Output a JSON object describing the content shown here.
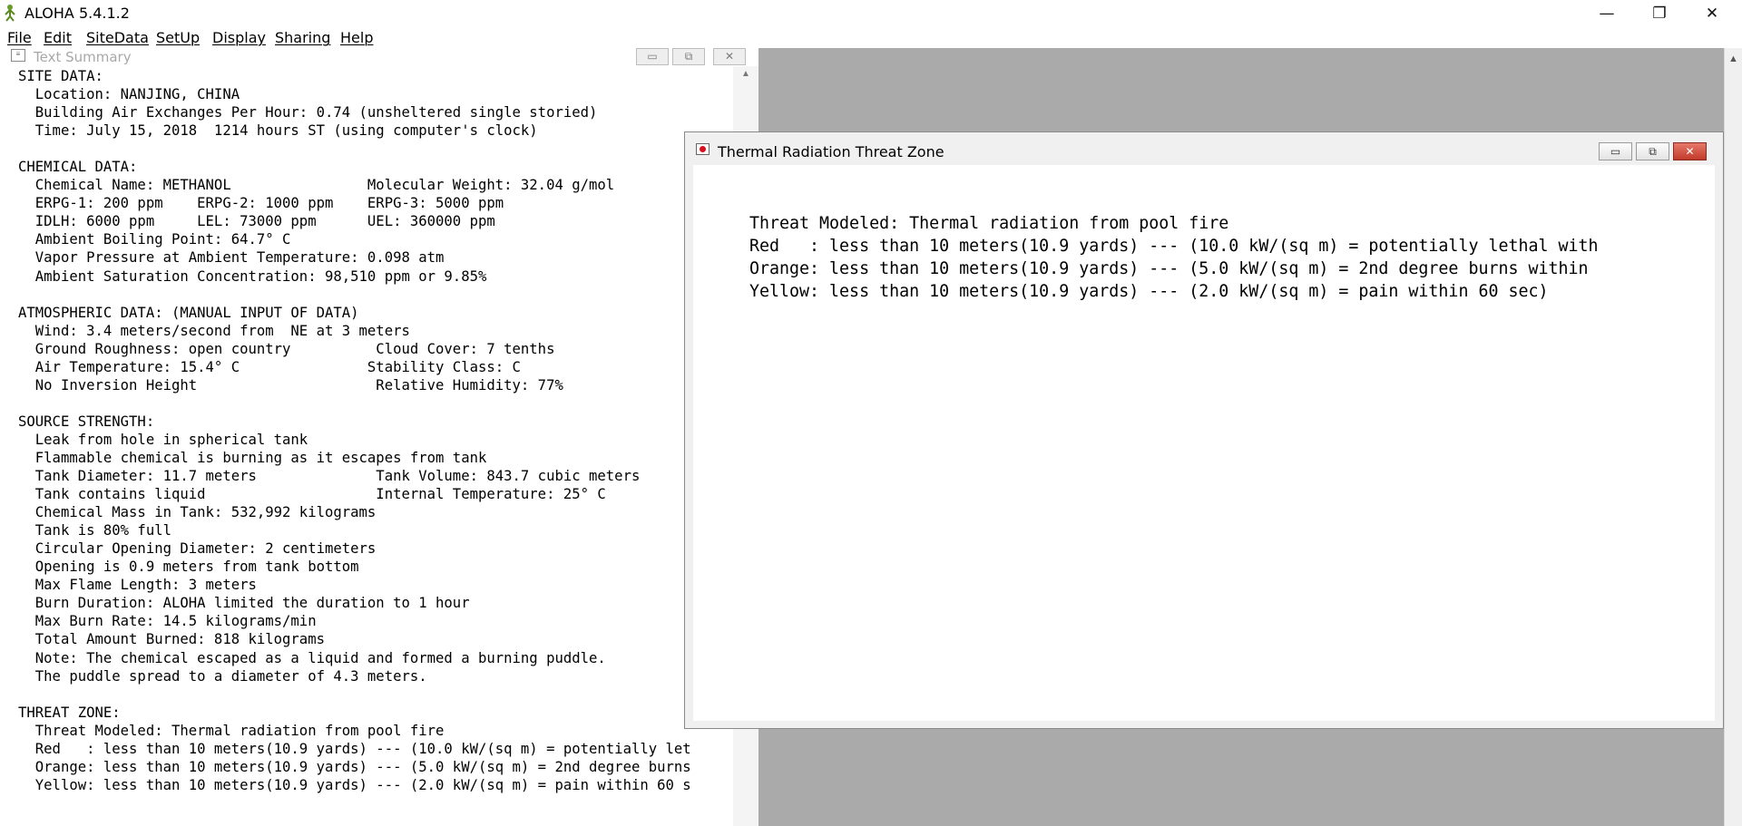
{
  "app": {
    "title": "ALOHA 5.4.1.2",
    "minimize": "—",
    "restore": "❐",
    "close": "✕"
  },
  "menu": {
    "file": "File",
    "edit": "Edit",
    "sitedata": "SiteData",
    "setup": "SetUp",
    "display": "Display",
    "sharing": "Sharing",
    "help": "Help"
  },
  "summary": {
    "title": "Text Summary",
    "content": "SITE DATA:\n  Location: NANJING, CHINA\n  Building Air Exchanges Per Hour: 0.74 (unsheltered single storied)\n  Time: July 15, 2018  1214 hours ST (using computer's clock)\n\nCHEMICAL DATA:\n  Chemical Name: METHANOL                Molecular Weight: 32.04 g/mol\n  ERPG-1: 200 ppm    ERPG-2: 1000 ppm    ERPG-3: 5000 ppm\n  IDLH: 6000 ppm     LEL: 73000 ppm      UEL: 360000 ppm\n  Ambient Boiling Point: 64.7° C\n  Vapor Pressure at Ambient Temperature: 0.098 atm\n  Ambient Saturation Concentration: 98,510 ppm or 9.85%\n\nATMOSPHERIC DATA: (MANUAL INPUT OF DATA)\n  Wind: 3.4 meters/second from  NE at 3 meters\n  Ground Roughness: open country          Cloud Cover: 7 tenths\n  Air Temperature: 15.4° C               Stability Class: C\n  No Inversion Height                     Relative Humidity: 77%\n\nSOURCE STRENGTH:\n  Leak from hole in spherical tank\n  Flammable chemical is burning as it escapes from tank\n  Tank Diameter: 11.7 meters              Tank Volume: 843.7 cubic meters\n  Tank contains liquid                    Internal Temperature: 25° C\n  Chemical Mass in Tank: 532,992 kilograms\n  Tank is 80% full\n  Circular Opening Diameter: 2 centimeters\n  Opening is 0.9 meters from tank bottom\n  Max Flame Length: 3 meters\n  Burn Duration: ALOHA limited the duration to 1 hour\n  Max Burn Rate: 14.5 kilograms/min\n  Total Amount Burned: 818 kilograms\n  Note: The chemical escaped as a liquid and formed a burning puddle.\n  The puddle spread to a diameter of 4.3 meters.\n\nTHREAT ZONE:\n  Threat Modeled: Thermal radiation from pool fire\n  Red   : less than 10 meters(10.9 yards) --- (10.0 kW/(sq m) = potentially let\n  Orange: less than 10 meters(10.9 yards) --- (5.0 kW/(sq m) = 2nd degree burns\n  Yellow: less than 10 meters(10.9 yards) --- (2.0 kW/(sq m) = pain within 60 s"
  },
  "threat_window": {
    "title": "Thermal Radiation Threat Zone",
    "content": "Threat Modeled: Thermal radiation from pool fire\nRed   : less than 10 meters(10.9 yards) --- (10.0 kW/(sq m) = potentially lethal with\nOrange: less than 10 meters(10.9 yards) --- (5.0 kW/(sq m) = 2nd degree burns within\nYellow: less than 10 meters(10.9 yards) --- (2.0 kW/(sq m) = pain within 60 sec)",
    "minimize": "▭",
    "restore": "⧉",
    "close": "✕"
  },
  "colors": {
    "mdi_background": "#aaaaaa",
    "close_button": "#c23b2a",
    "threat_icon": "#d8101e"
  }
}
